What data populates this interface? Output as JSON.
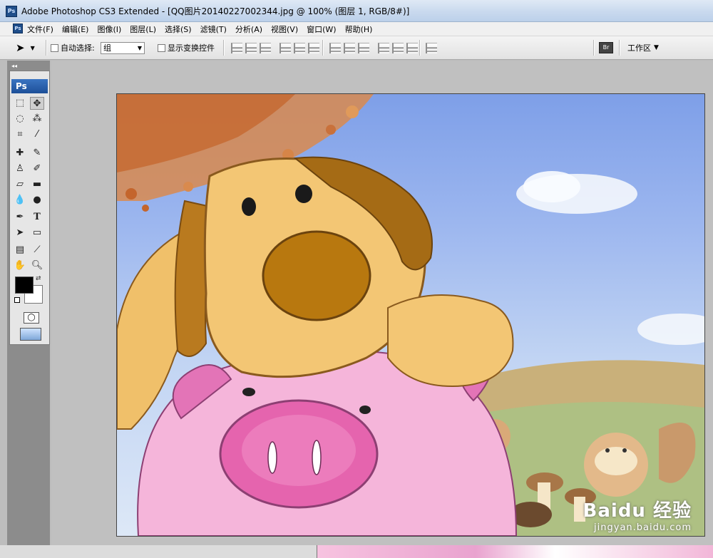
{
  "window": {
    "title": "Adobe Photoshop CS3 Extended - [QQ图片20140227002344.jpg @ 100% (图层 1, RGB/8#)]",
    "app_badge": "Ps"
  },
  "menu": {
    "badge": "Ps",
    "items": [
      "文件(F)",
      "编辑(E)",
      "图像(I)",
      "图层(L)",
      "选择(S)",
      "滤镜(T)",
      "分析(A)",
      "视图(V)",
      "窗口(W)",
      "帮助(H)"
    ]
  },
  "options": {
    "auto_select_label": "自动选择:",
    "auto_select_value": "组",
    "show_transform_label": "显示变换控件",
    "workspace_label": "工作区"
  },
  "toolbox": {
    "header": "Ps",
    "collapse_glyph": "◂◂"
  },
  "watermark": {
    "brand": "Baidu 经验",
    "url": "jingyan.baidu.com"
  },
  "colors": {
    "foreground": "#000000",
    "background": "#ffffff",
    "accent": "#1d4f98"
  }
}
